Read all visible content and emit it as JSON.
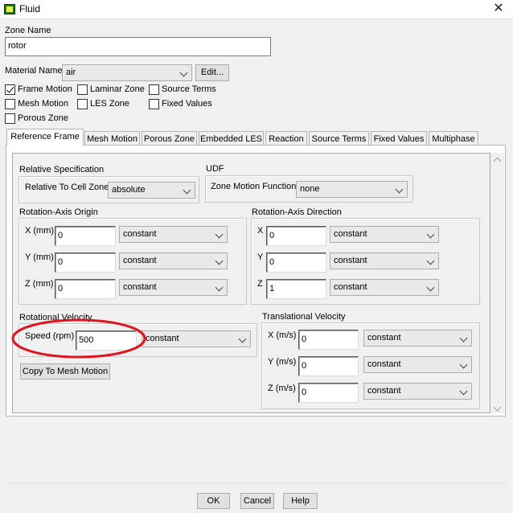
{
  "window": {
    "title": "Fluid",
    "close": "✕"
  },
  "zone_name": {
    "label": "Zone Name",
    "value": "rotor"
  },
  "material": {
    "label": "Material Name",
    "value": "air",
    "edit_button": "Edit..."
  },
  "options": {
    "frame_motion": {
      "label": "Frame Motion",
      "checked": true
    },
    "laminar_zone": {
      "label": "Laminar Zone",
      "checked": false
    },
    "source_terms": {
      "label": "Source Terms",
      "checked": false
    },
    "mesh_motion": {
      "label": "Mesh Motion",
      "checked": false
    },
    "les_zone": {
      "label": "LES Zone",
      "checked": false
    },
    "fixed_values": {
      "label": "Fixed Values",
      "checked": false
    },
    "porous_zone": {
      "label": "Porous Zone",
      "checked": false
    }
  },
  "tabs": [
    {
      "label": "Reference Frame"
    },
    {
      "label": "Mesh Motion"
    },
    {
      "label": "Porous Zone"
    },
    {
      "label": "Embedded LES"
    },
    {
      "label": "Reaction"
    },
    {
      "label": "Source Terms"
    },
    {
      "label": "Fixed Values"
    },
    {
      "label": "Multiphase"
    }
  ],
  "relative_spec": {
    "title": "Relative Specification",
    "label": "Relative To Cell Zone",
    "value": "absolute"
  },
  "udf": {
    "title": "UDF",
    "label": "Zone Motion Function",
    "value": "none"
  },
  "axis_origin": {
    "title": "Rotation-Axis Origin",
    "x": {
      "label": "X (mm)",
      "value": "0",
      "method": "constant"
    },
    "y": {
      "label": "Y (mm)",
      "value": "0",
      "method": "constant"
    },
    "z": {
      "label": "Z (mm)",
      "value": "0",
      "method": "constant"
    }
  },
  "axis_direction": {
    "title": "Rotation-Axis Direction",
    "x": {
      "label": "X",
      "value": "0",
      "method": "constant"
    },
    "y": {
      "label": "Y",
      "value": "0",
      "method": "constant"
    },
    "z": {
      "label": "Z",
      "value": "1",
      "method": "constant"
    }
  },
  "rotational_velocity": {
    "title": "Rotational Velocity",
    "speed": {
      "label": "Speed (rpm)",
      "value": "500",
      "method": "constant"
    },
    "copy_button": "Copy To Mesh Motion",
    "highlight_color": "#e0141c"
  },
  "translational_velocity": {
    "title": "Translational Velocity",
    "x": {
      "label": "X (m/s)",
      "value": "0",
      "method": "constant"
    },
    "y": {
      "label": "Y (m/s)",
      "value": "0",
      "method": "constant"
    },
    "z": {
      "label": "Z (m/s)",
      "value": "0",
      "method": "constant"
    }
  },
  "footer": {
    "ok": "OK",
    "cancel": "Cancel",
    "help": "Help"
  }
}
